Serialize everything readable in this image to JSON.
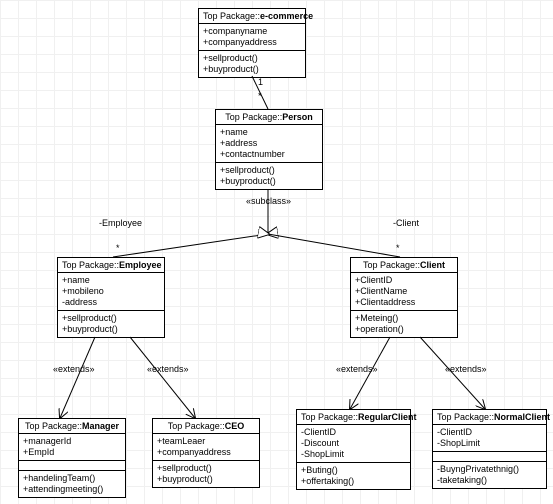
{
  "packagePrefix": "Top Package::",
  "classes": {
    "ecommerce": {
      "name": "e-commerce",
      "attrs": [
        "+companyname",
        "+companyaddress"
      ],
      "ops": [
        "+sellproduct()",
        "+buyproduct()"
      ]
    },
    "person": {
      "name": "Person",
      "attrs": [
        "+name",
        "+address",
        "+contactnumber"
      ],
      "ops": [
        "+sellproduct()",
        "+buyproduct()"
      ]
    },
    "employee": {
      "name": "Employee",
      "attrs": [
        "+name",
        "+mobileno",
        "-address"
      ],
      "ops": [
        "+sellproduct()",
        "+buyproduct()"
      ]
    },
    "client": {
      "name": "Client",
      "attrs": [
        "+ClientID",
        "+ClientName",
        "+Clientaddress"
      ],
      "ops": [
        "+Meteing()",
        "+operation()"
      ]
    },
    "manager": {
      "name": "Manager",
      "attrs": [
        "+managerId",
        "+EmpId"
      ],
      "ops": [
        "+handelingTeam()",
        "+attendingmeeting()"
      ]
    },
    "ceo": {
      "name": "CEO",
      "attrs": [
        "+teamLeaer",
        "+companyaddress"
      ],
      "ops": [
        "+sellproduct()",
        "+buyproduct()"
      ]
    },
    "regularclient": {
      "name": "RegularClient",
      "attrs": [
        "-ClientID",
        "-Discount",
        "-ShopLimit"
      ],
      "ops": [
        "+Buting()",
        "+offertaking()"
      ]
    },
    "normalclient": {
      "name": "NormalClient",
      "attrs": [
        "-ClientID",
        "-ShopLimit"
      ],
      "ops": [
        "-BuyngPrivatethnig()",
        "-taketaking()"
      ]
    }
  },
  "labels": {
    "subclass": "«subclass»",
    "extends": "«extends»",
    "employee": "-Employee",
    "client": "-Client",
    "one": "1",
    "star": "*"
  },
  "chart_data": {
    "type": "table",
    "description": "UML class diagram depicting an e-commerce package hierarchy.",
    "nodes": [
      {
        "id": "e-commerce",
        "stereotype": "Top Package",
        "attributes": [
          "companyname",
          "companyaddress"
        ],
        "operations": [
          "sellproduct()",
          "buyproduct()"
        ]
      },
      {
        "id": "Person",
        "stereotype": "Top Package",
        "attributes": [
          "name",
          "address",
          "contactnumber"
        ],
        "operations": [
          "sellproduct()",
          "buyproduct()"
        ]
      },
      {
        "id": "Employee",
        "stereotype": "Top Package",
        "attributes": [
          "name",
          "mobileno",
          "address"
        ],
        "operations": [
          "sellproduct()",
          "buyproduct()"
        ]
      },
      {
        "id": "Client",
        "stereotype": "Top Package",
        "attributes": [
          "ClientID",
          "ClientName",
          "Clientaddress"
        ],
        "operations": [
          "Meteing()",
          "operation()"
        ]
      },
      {
        "id": "Manager",
        "stereotype": "Top Package",
        "attributes": [
          "managerId",
          "EmpId"
        ],
        "operations": [
          "handelingTeam()",
          "attendingmeeting()"
        ]
      },
      {
        "id": "CEO",
        "stereotype": "Top Package",
        "attributes": [
          "teamLeaer",
          "companyaddress"
        ],
        "operations": [
          "sellproduct()",
          "buyproduct()"
        ]
      },
      {
        "id": "RegularClient",
        "stereotype": "Top Package",
        "attributes": [
          "ClientID",
          "Discount",
          "ShopLimit"
        ],
        "operations": [
          "Buting()",
          "offertaking()"
        ]
      },
      {
        "id": "NormalClient",
        "stereotype": "Top Package",
        "attributes": [
          "ClientID",
          "ShopLimit"
        ],
        "operations": [
          "BuyngPrivatethnig()",
          "taketaking()"
        ]
      }
    ],
    "edges": [
      {
        "from": "e-commerce",
        "to": "Person",
        "type": "association",
        "multiplicity_from": "1",
        "multiplicity_to": "*"
      },
      {
        "from": "Person",
        "to": "Employee",
        "type": "generalization",
        "label": "subclass",
        "role": "Employee",
        "multiplicity": "*"
      },
      {
        "from": "Person",
        "to": "Client",
        "type": "generalization",
        "label": "subclass",
        "role": "Client",
        "multiplicity": "*"
      },
      {
        "from": "Employee",
        "to": "Manager",
        "type": "extends"
      },
      {
        "from": "Employee",
        "to": "CEO",
        "type": "extends"
      },
      {
        "from": "Client",
        "to": "RegularClient",
        "type": "extends"
      },
      {
        "from": "Client",
        "to": "NormalClient",
        "type": "extends"
      }
    ]
  }
}
